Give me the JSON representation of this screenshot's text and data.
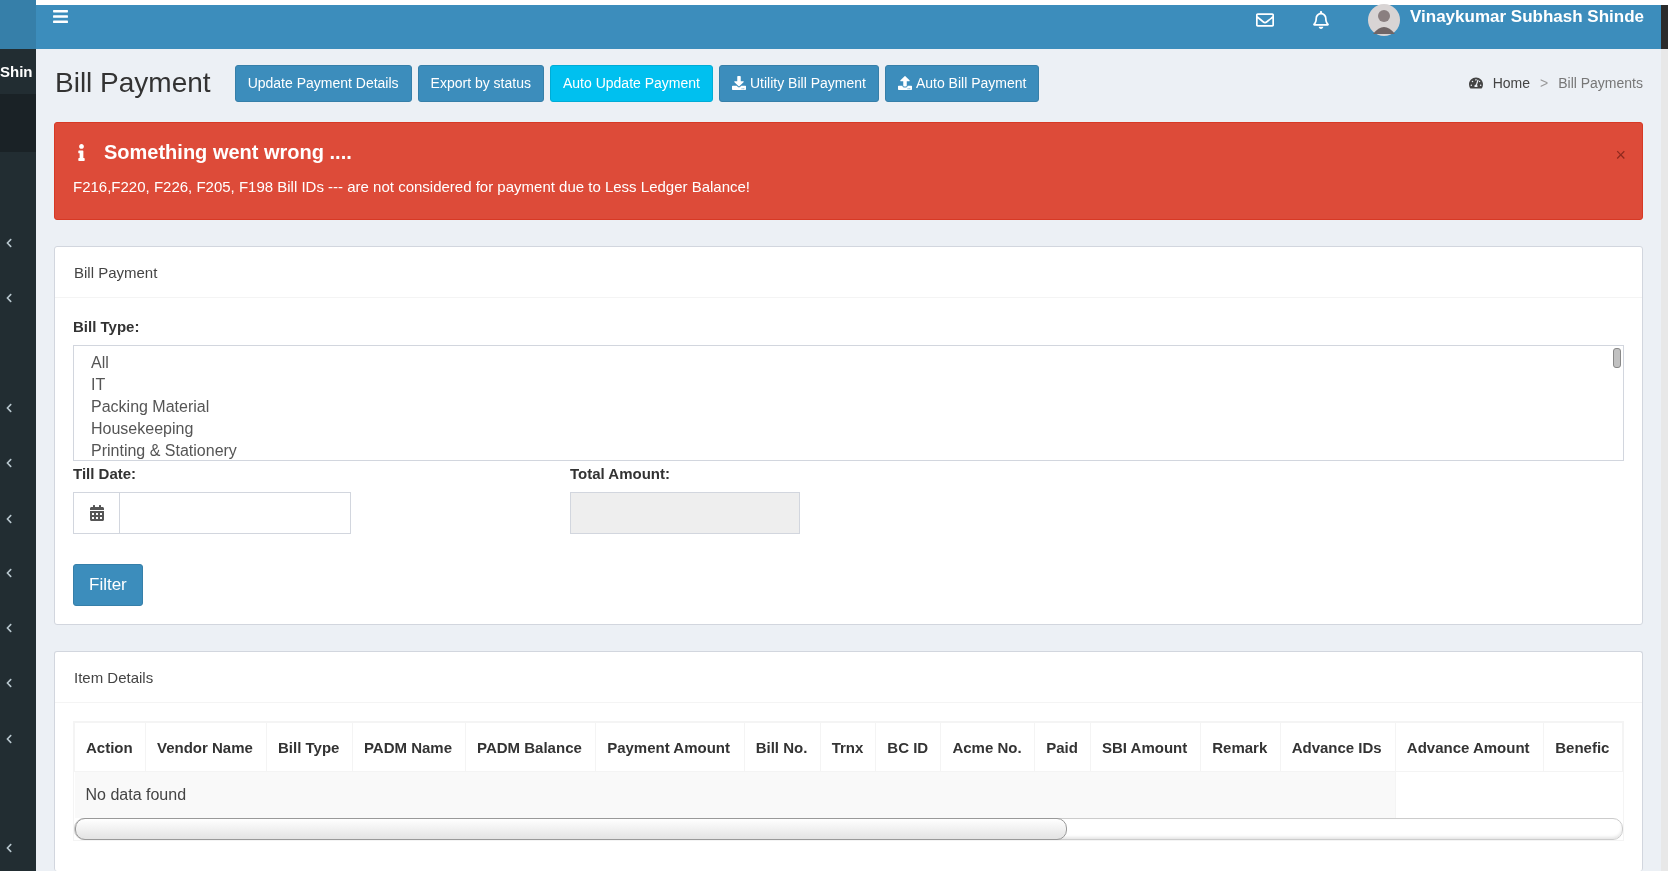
{
  "sidebar": {
    "user_name_fragment": "Shin",
    "items": [
      {
        "expanded": false
      },
      {
        "expanded": false
      },
      {
        "expanded": false
      },
      {
        "expanded": false
      },
      {
        "expanded": false
      },
      {
        "expanded": false
      },
      {
        "expanded": false
      },
      {
        "expanded": false
      },
      {
        "expanded": false
      },
      {
        "expanded": false
      }
    ]
  },
  "topbar": {
    "user_name": "Vinaykumar Subhash Shinde"
  },
  "header": {
    "title": "Bill Payment",
    "buttons": [
      {
        "label": "Update Payment Details",
        "kind": "primary"
      },
      {
        "label": "Export by status",
        "kind": "primary"
      },
      {
        "label": "Auto Update Payment",
        "kind": "info"
      },
      {
        "label": "Utility Bill Payment",
        "kind": "download"
      },
      {
        "label": "Auto Bill Payment",
        "kind": "upload"
      }
    ],
    "breadcrumb": [
      {
        "label": "Home"
      },
      {
        "label": "Bill Payments"
      }
    ],
    "breadcrumb_separator": ">"
  },
  "alert": {
    "title": "Something went wrong ....",
    "message": "F216,F220, F226, F205, F198 Bill IDs --- are not considered for payment due to Less Ledger Balance!",
    "close": "×"
  },
  "filter_box": {
    "title": "Bill Payment",
    "bill_type_label": "Bill Type:",
    "bill_types": [
      "All",
      "IT",
      "Packing Material",
      "Housekeeping",
      "Printing & Stationery"
    ],
    "till_date_label": "Till Date:",
    "total_amount_label": "Total Amount:",
    "filter_button": "Filter"
  },
  "items_box": {
    "title": "Item Details",
    "columns": [
      "Action",
      "Vendor Name",
      "Bill Type",
      "PADM Name",
      "PADM Balance",
      "Payment Amount",
      "Bill No.",
      "Trnx",
      "BC ID",
      "Acme No.",
      "Paid",
      "SBI Amount",
      "Remark",
      "Advance IDs",
      "Advance Amount",
      "Benefic"
    ],
    "empty_message": "No data found"
  }
}
